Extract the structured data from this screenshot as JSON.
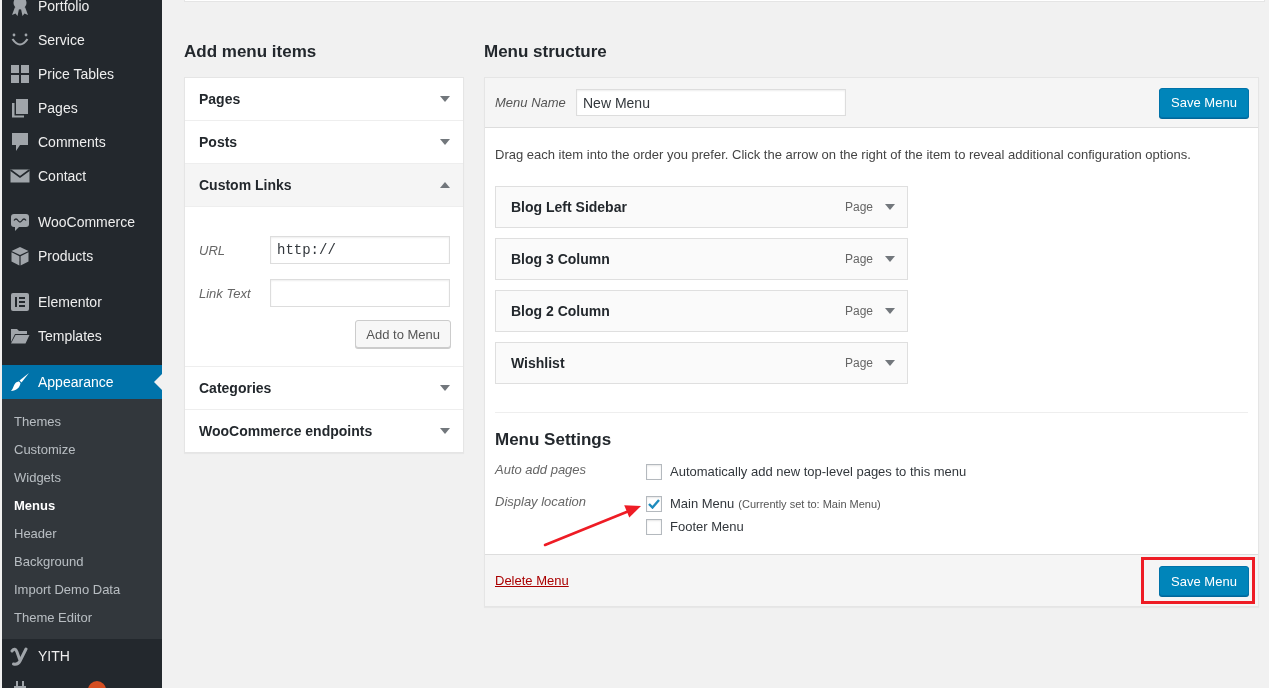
{
  "sidebar": {
    "groups": [
      {
        "items": [
          {
            "label": "Portfolio",
            "selected": false,
            "badge": false
          },
          {
            "label": "Service",
            "selected": false,
            "badge": false
          },
          {
            "label": "Price Tables",
            "selected": false,
            "badge": false
          },
          {
            "label": "Pages",
            "selected": false,
            "badge": false
          },
          {
            "label": "Comments",
            "selected": false,
            "badge": false
          },
          {
            "label": "Contact",
            "selected": false,
            "badge": false
          }
        ]
      },
      {
        "items": [
          {
            "label": "WooCommerce",
            "selected": false,
            "badge": false
          },
          {
            "label": "Products",
            "selected": false,
            "badge": false
          }
        ]
      },
      {
        "items": [
          {
            "label": "Elementor",
            "selected": false,
            "badge": false
          },
          {
            "label": "Templates",
            "selected": false,
            "badge": false
          }
        ]
      },
      {
        "items": [
          {
            "label": "Appearance",
            "selected": true,
            "badge": false,
            "children": [
              {
                "label": "Themes",
                "selected": false
              },
              {
                "label": "Customize",
                "selected": false
              },
              {
                "label": "Widgets",
                "selected": false
              },
              {
                "label": "Menus",
                "selected": true
              },
              {
                "label": "Header",
                "selected": false
              },
              {
                "label": "Background",
                "selected": false
              },
              {
                "label": "Import Demo Data",
                "selected": false
              },
              {
                "label": "Theme Editor",
                "selected": false
              }
            ]
          },
          {
            "label": "YITH",
            "selected": false,
            "badge": false
          },
          {
            "selected": false,
            "badge": true
          }
        ]
      }
    ]
  },
  "add_menu_items": {
    "title": "Add menu items",
    "sections": [
      {
        "title": "Pages",
        "expanded": false
      },
      {
        "title": "Posts",
        "expanded": false
      },
      {
        "title": "Custom Links",
        "expanded": true,
        "fields": [
          {
            "kind": "url",
            "label": "URL",
            "value": "http://"
          },
          {
            "kind": "text",
            "label": "Link Text"
          }
        ],
        "button": "Add to Menu"
      },
      {
        "title": "Categories",
        "expanded": false
      },
      {
        "title": "WooCommerce endpoints",
        "expanded": false
      }
    ]
  },
  "menu_structure": {
    "title": "Menu structure",
    "menu_name": {
      "label": "Menu Name",
      "value": "New Menu"
    },
    "save_button": "Save Menu",
    "instructions": "Drag each item into the order you prefer. Click the arrow on the right of the item to reveal additional configuration options.",
    "items": [
      {
        "title": "Blog Left Sidebar",
        "item_type": "Page",
        "expanded": false
      },
      {
        "title": "Blog 3 Column",
        "item_type": "Page",
        "expanded": false
      },
      {
        "title": "Blog 2 Column",
        "item_type": "Page",
        "expanded": false
      },
      {
        "title": "Wishlist",
        "item_type": "Page",
        "expanded": false
      }
    ],
    "settings": {
      "title": "Menu Settings",
      "rows": [
        {
          "label": "Auto add pages",
          "options": [
            {
              "label": "Automatically add new top-level pages to this menu",
              "checked": false
            }
          ]
        },
        {
          "label": "Display location",
          "options": [
            {
              "label": "Main Menu",
              "note": "(Currently set to: Main Menu)",
              "checked": true
            },
            {
              "label": "Footer Menu",
              "checked": false
            }
          ]
        }
      ]
    },
    "delete_link": "Delete Menu",
    "footer_save_button": "Save Menu"
  },
  "annotations": {
    "arrow": true,
    "highlight_frame": true
  }
}
